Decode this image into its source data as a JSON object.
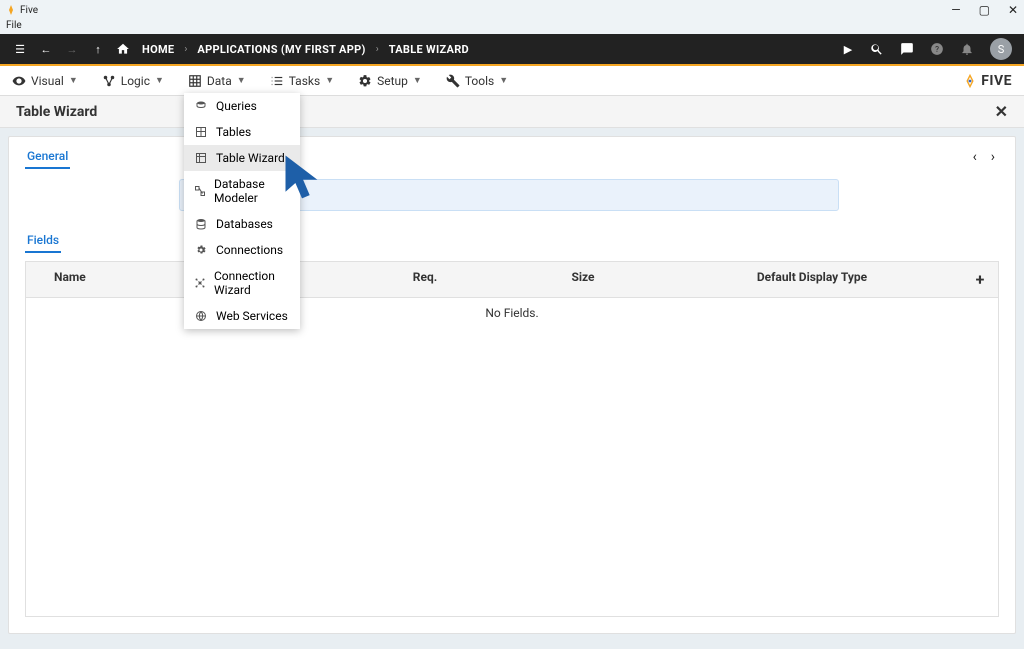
{
  "window": {
    "app": "Five",
    "file_menu": "File",
    "min": "—",
    "max": "▢",
    "close": "✕",
    "avatar": "S"
  },
  "breadcrumb": {
    "home": "HOME",
    "applications": "APPLICATIONS (MY FIRST APP)",
    "table_wizard": "TABLE WIZARD"
  },
  "secondary_nav": {
    "visual": "Visual",
    "logic": "Logic",
    "data": "Data",
    "tasks": "Tasks",
    "setup": "Setup",
    "tools": "Tools",
    "brand": "FIVE"
  },
  "page": {
    "title": "Table Wizard",
    "general_tab": "General",
    "fields_tab": "Fields"
  },
  "table": {
    "col_name": "Name",
    "col_req": "Req.",
    "col_size": "Size",
    "col_type": "Default Display Type",
    "empty": "No Fields."
  },
  "data_menu": {
    "queries": "Queries",
    "tables": "Tables",
    "table_wizard": "Table Wizard",
    "database_modeler": "Database Modeler",
    "databases": "Databases",
    "connections": "Connections",
    "connection_wizard": "Connection Wizard",
    "web_services": "Web Services"
  }
}
